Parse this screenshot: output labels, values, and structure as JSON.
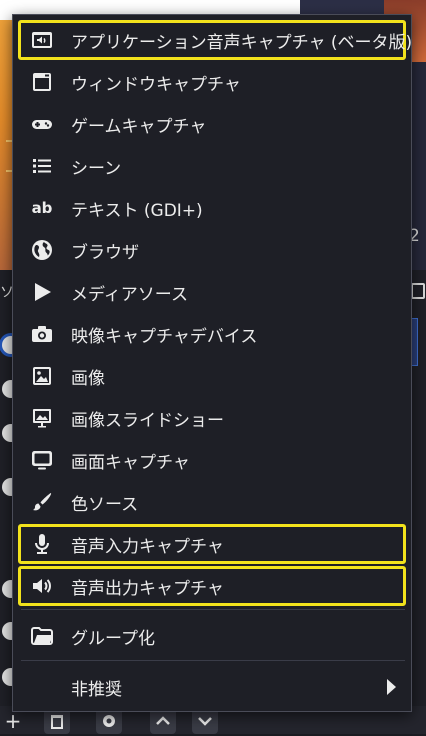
{
  "menu": {
    "items": [
      {
        "id": "app-audio",
        "label": "アプリケーション音声キャプチャ (ベータ版)",
        "icon": "app-audio-capture-icon",
        "highlighted": true
      },
      {
        "id": "window",
        "label": "ウィンドウキャプチャ",
        "icon": "window-capture-icon",
        "highlighted": false
      },
      {
        "id": "game",
        "label": "ゲームキャプチャ",
        "icon": "gamepad-icon",
        "highlighted": false
      },
      {
        "id": "scene",
        "label": "シーン",
        "icon": "scene-list-icon",
        "highlighted": false
      },
      {
        "id": "text",
        "label": "テキスト (GDI+)",
        "icon": "text-icon",
        "highlighted": false
      },
      {
        "id": "browser",
        "label": "ブラウザ",
        "icon": "globe-icon",
        "highlighted": false
      },
      {
        "id": "media",
        "label": "メディアソース",
        "icon": "play-icon",
        "highlighted": false
      },
      {
        "id": "video-device",
        "label": "映像キャプチャデバイス",
        "icon": "camera-icon",
        "highlighted": false
      },
      {
        "id": "image",
        "label": "画像",
        "icon": "image-icon",
        "highlighted": false
      },
      {
        "id": "slideshow",
        "label": "画像スライドショー",
        "icon": "slideshow-icon",
        "highlighted": false
      },
      {
        "id": "display",
        "label": "画面キャプチャ",
        "icon": "monitor-icon",
        "highlighted": false
      },
      {
        "id": "color",
        "label": "色ソース",
        "icon": "paint-brush-icon",
        "highlighted": false
      },
      {
        "id": "audio-input",
        "label": "音声入力キャプチャ",
        "icon": "microphone-icon",
        "highlighted": true
      },
      {
        "id": "audio-output",
        "label": "音声出力キャプチャ",
        "icon": "speaker-icon",
        "highlighted": true
      }
    ],
    "group": {
      "label": "グループ化",
      "icon": "folder-icon"
    },
    "deprecated": {
      "label": "非推奨",
      "icon": "submenu-arrow-icon"
    }
  },
  "background": {
    "dock_title": "ソー",
    "right_digit": "2"
  },
  "colors": {
    "highlight": "#f2e21c",
    "menu_bg": "#1e1f26"
  }
}
